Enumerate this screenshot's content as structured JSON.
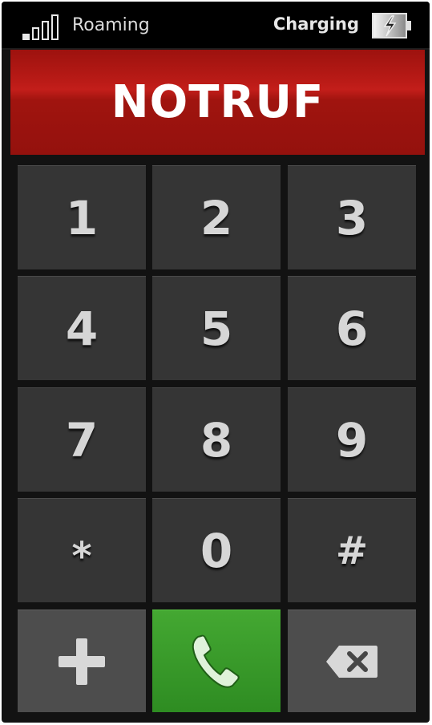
{
  "status_bar": {
    "signal_icon": "signal-bars-icon",
    "network_status": "Roaming",
    "battery_status": "Charging",
    "battery_icon": "battery-charging-icon"
  },
  "header": {
    "title": "NOTRUF"
  },
  "keypad": {
    "keys": [
      "1",
      "2",
      "3",
      "4",
      "5",
      "6",
      "7",
      "8",
      "9",
      "*",
      "0",
      "#"
    ]
  },
  "actions": {
    "add_icon": "plus-icon",
    "call_icon": "phone-handset-icon",
    "delete_icon": "backspace-icon"
  },
  "colors": {
    "emergency_red": "#a0140f",
    "call_green": "#3a9a2a",
    "key_background": "#353535",
    "text_light": "#d6d6d6"
  }
}
